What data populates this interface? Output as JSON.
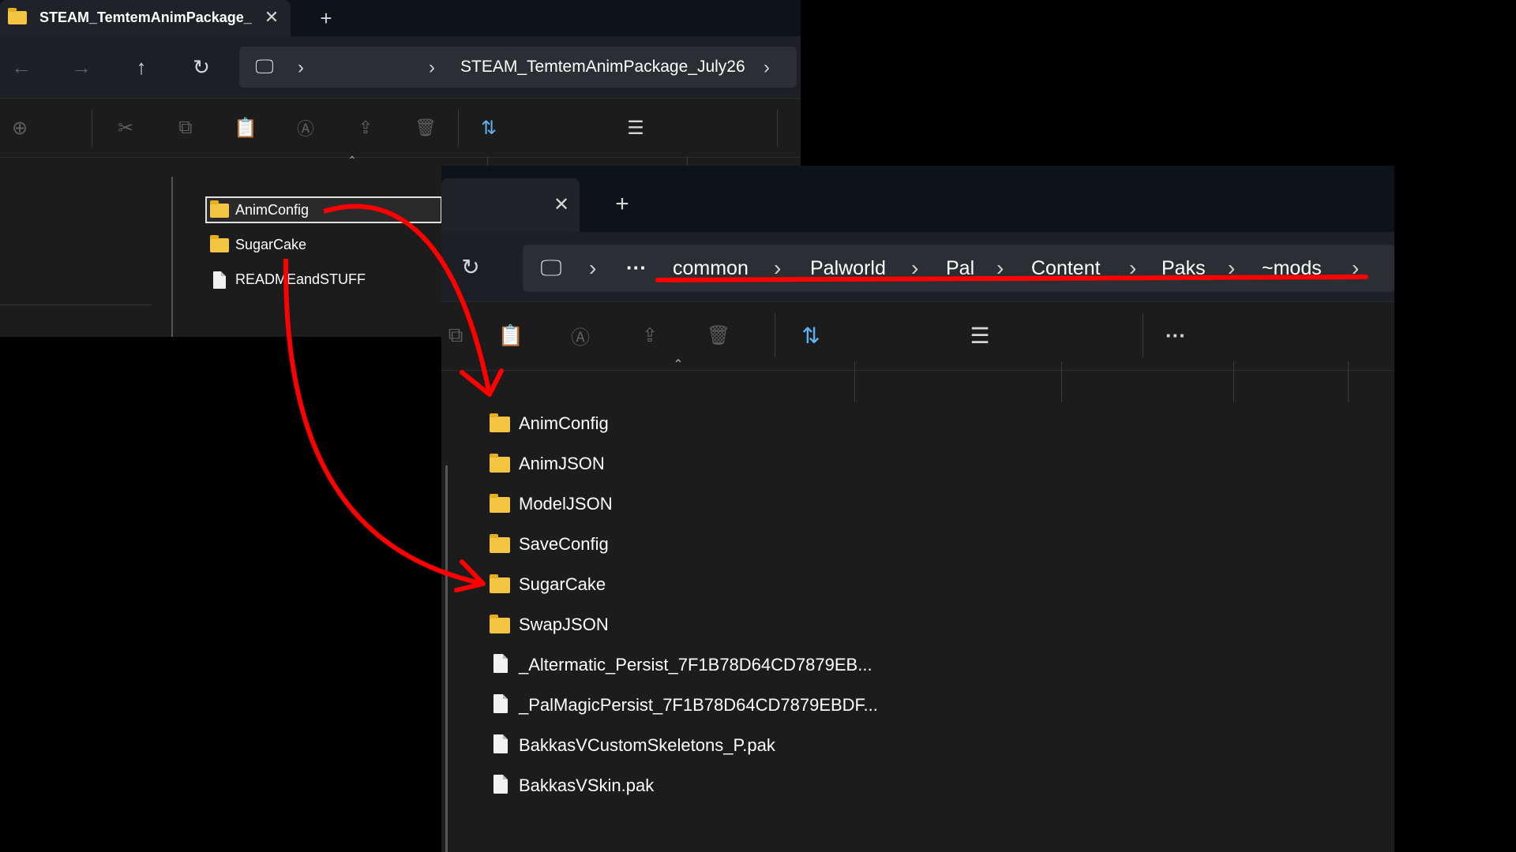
{
  "back_window": {
    "tab_title": "STEAM_TemtemAnimPackage_",
    "breadcrumb": "STEAM_TemtemAnimPackage_July26",
    "files": [
      {
        "name": "AnimConfig",
        "type": "folder"
      },
      {
        "name": "SugarCake",
        "type": "folder"
      },
      {
        "name": "READMEandSTUFF",
        "type": "file"
      }
    ]
  },
  "front_window": {
    "breadcrumbs": [
      "common",
      "Palworld",
      "Pal",
      "Content",
      "Paks",
      "~mods"
    ],
    "more_label": "···",
    "files": [
      {
        "name": "AnimConfig",
        "type": "folder"
      },
      {
        "name": "AnimJSON",
        "type": "folder"
      },
      {
        "name": "ModelJSON",
        "type": "folder"
      },
      {
        "name": "SaveConfig",
        "type": "folder"
      },
      {
        "name": "SugarCake",
        "type": "folder"
      },
      {
        "name": "SwapJSON",
        "type": "folder"
      },
      {
        "name": "_Altermatic_Persist_7F1B78D64CD7879EB...",
        "type": "file"
      },
      {
        "name": "_PalMagicPersist_7F1B78D64CD7879EBDF...",
        "type": "file"
      },
      {
        "name": "BakkasVCustomSkeletons_P.pak",
        "type": "file"
      },
      {
        "name": "BakkasVSkin.pak",
        "type": "file"
      }
    ]
  },
  "colors": {
    "annotation": "#ff0000",
    "folder": "#f4c542",
    "accent": "#5fb2f2"
  }
}
